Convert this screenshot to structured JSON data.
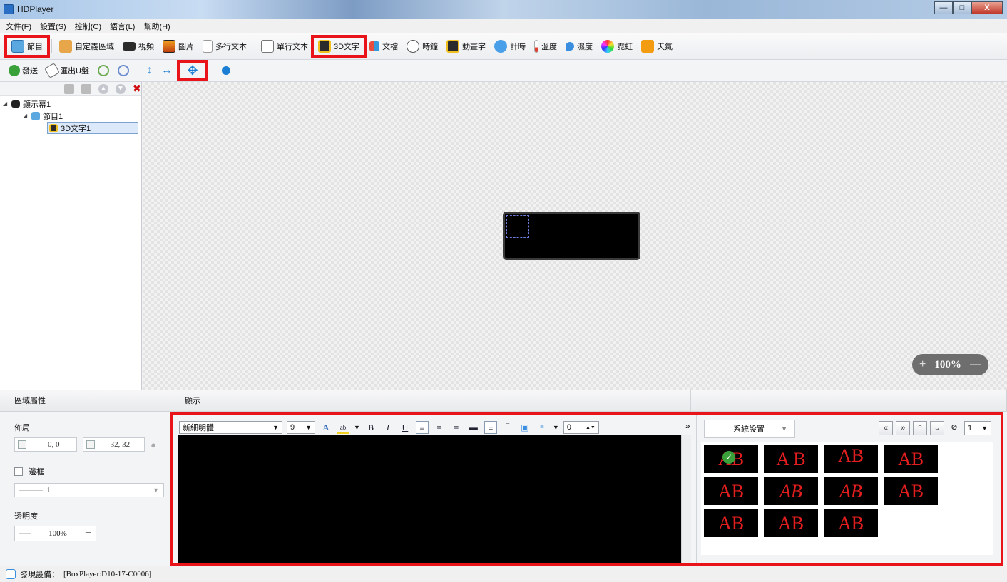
{
  "window": {
    "title": "HDPlayer"
  },
  "menu": [
    "文件(F)",
    "設置(S)",
    "控制(C)",
    "語言(L)",
    "幫助(H)"
  ],
  "toolbar_main": {
    "program": "節目",
    "custom_area": "自定義區域",
    "video": "視頻",
    "picture": "圖片",
    "multiline_text": "多行文本",
    "singleline_text": "單行文本",
    "text_3d": "3D文字",
    "document": "文檔",
    "clock": "時鐘",
    "animated_text": "動畫字",
    "timer": "計時",
    "temperature": "溫度",
    "humidity": "濕度",
    "neon": "霓虹",
    "weather": "天氣"
  },
  "toolbar_secondary": {
    "send": "發送",
    "export_u": "匯出U盤"
  },
  "tree": {
    "screen": "顯示幕1",
    "program": "節目1",
    "item": "3D文字1"
  },
  "canvas": {
    "zoom": "100%"
  },
  "properties": {
    "header": "區域屬性",
    "layout_label": "佈局",
    "position": "0, 0",
    "size": "32, 32",
    "border_label": "邊框",
    "border_width": "1",
    "opacity_label": "透明度",
    "opacity": "100%"
  },
  "display": {
    "header": "顯示",
    "font": "新細明體",
    "font_size": "9",
    "spacing": "0"
  },
  "effects": {
    "preset_select": "系統設置",
    "page_value": "1",
    "tiles": [
      "AB",
      "A B",
      "AB",
      "AB",
      "AB",
      "AB",
      "AB",
      "AB",
      "AB",
      "AB",
      "AB"
    ],
    "text_color": "#e41e1e"
  },
  "status": {
    "label": "發現設備：",
    "device": "[BoxPlayer:D10-17-C0006]"
  },
  "colors": {
    "highlight": "#e8141a",
    "accent": "#1a7fd4"
  }
}
